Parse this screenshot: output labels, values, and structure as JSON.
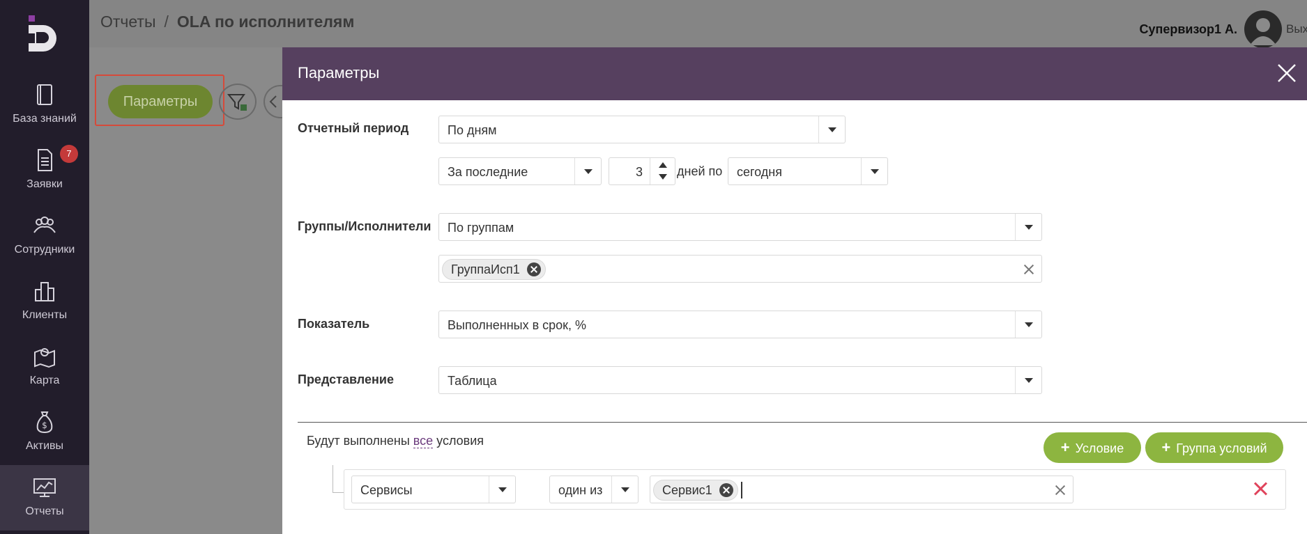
{
  "sidebar": {
    "items": [
      {
        "label": "База знаний",
        "icon": "book-icon"
      },
      {
        "label": "Заявки",
        "icon": "document-icon",
        "badge": "7"
      },
      {
        "label": "Сотрудники",
        "icon": "people-icon"
      },
      {
        "label": "Клиенты",
        "icon": "buildings-icon"
      },
      {
        "label": "Карта",
        "icon": "map-icon"
      },
      {
        "label": "Активы",
        "icon": "money-bag-icon"
      },
      {
        "label": "Отчеты",
        "icon": "chart-monitor-icon"
      }
    ]
  },
  "header": {
    "breadcrumb_parent": "Отчеты",
    "breadcrumb_sep": "/",
    "breadcrumb_current": "OLA по исполнителям",
    "user_name": "Супервизор1 А.",
    "exit_label": "Выход"
  },
  "toolbar": {
    "params_label": "Параметры"
  },
  "modal": {
    "title": "Параметры",
    "period": {
      "label": "Отчетный период",
      "value": "По дням",
      "range_value": "За последние",
      "days": "3",
      "days_text": "дней по",
      "end_value": "сегодня"
    },
    "groups": {
      "label": "Группы/Исполнители",
      "value": "По группам",
      "tags": [
        "ГруппаИсп1"
      ]
    },
    "metric": {
      "label": "Показатель",
      "value": "Выполненных в срок, %"
    },
    "view": {
      "label": "Представление",
      "value": "Таблица"
    },
    "conditions": {
      "prefix": "Будут выполнены",
      "link": "все",
      "suffix": "условия",
      "add_condition": "Условие",
      "add_group": "Группа условий",
      "rows": [
        {
          "field": "Сервисы",
          "operator": "один из",
          "tags": [
            "Сервис1"
          ]
        }
      ]
    }
  },
  "colors": {
    "sidebar_bg": "#221d2b",
    "modal_header": "#56405f",
    "green_button": "#8db540",
    "delete_red": "#e0445c"
  }
}
